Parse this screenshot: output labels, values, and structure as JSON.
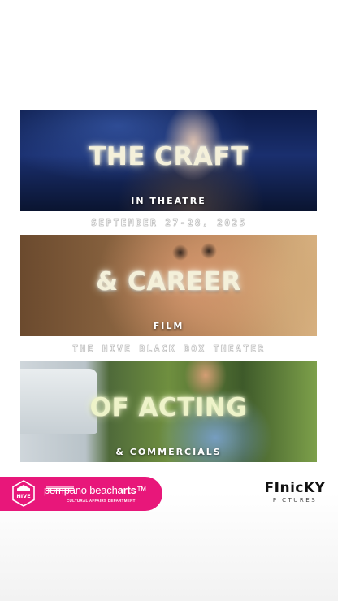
{
  "panels": [
    {
      "title": "THE CRAFT",
      "subtitle": "IN THEATRE"
    },
    {
      "title": "& CAREER",
      "subtitle": "FILM"
    },
    {
      "title": "OF ACTING",
      "subtitle": "& COMMERCIALS"
    }
  ],
  "event": {
    "dates": "SEPTEMBER 27-28, 2025",
    "venue": "THE HIVE BLACK BOX THEATER"
  },
  "partners": {
    "hive_logo_text": "HIVE",
    "pompano_name_a": "pompano beach",
    "pompano_name_b": "arts",
    "pompano_subtitle": "CULTURAL AFFAIRS DEPARTMENT",
    "finicky_title": "FInicKY",
    "finicky_subtitle": "PICTURES"
  },
  "colors": {
    "accent_pink": "#e8177a",
    "title_glow": "#f4f0da"
  },
  "icons": {
    "hive_logo": "hexagon-icon",
    "pompano_logo": "bars-icon"
  }
}
